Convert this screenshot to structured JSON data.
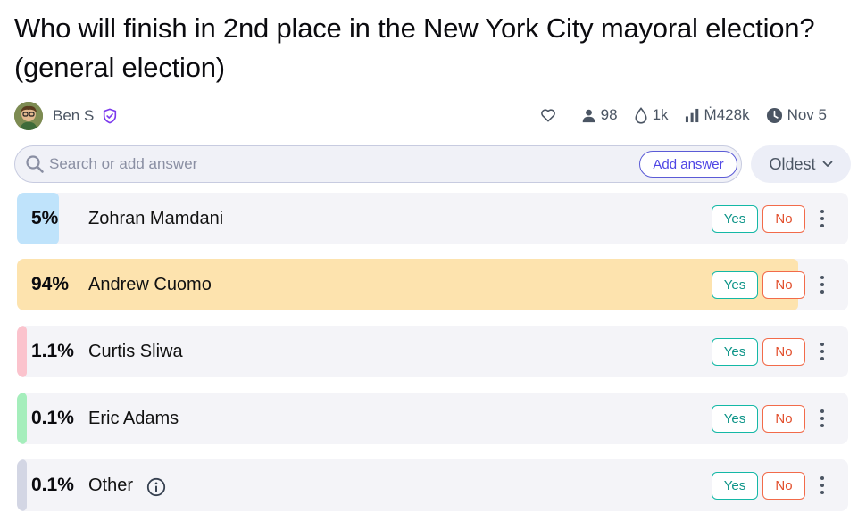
{
  "market": {
    "title": "Who will finish in 2nd place in the New York City mayoral election? (general election)",
    "author": "Ben S"
  },
  "stats": {
    "traders": "98",
    "liquidity": "1k",
    "volume": "Ṁ428k",
    "close_date": "Nov 5"
  },
  "search": {
    "placeholder": "Search or add answer",
    "add_label": "Add answer"
  },
  "sort": {
    "label": "Oldest"
  },
  "answers": [
    {
      "percent": "5%",
      "name": "Zohran Mamdani",
      "probability": 0.05,
      "color": "#bfe3fb",
      "yes": "Yes",
      "no": "No"
    },
    {
      "percent": "94%",
      "name": "Andrew Cuomo",
      "probability": 0.94,
      "color": "#fde3ae",
      "yes": "Yes",
      "no": "No"
    },
    {
      "percent": "1.1%",
      "name": "Curtis Sliwa",
      "probability": 0.011,
      "color": "#fbc3cd",
      "yes": "Yes",
      "no": "No"
    },
    {
      "percent": "0.1%",
      "name": "Eric Adams",
      "probability": 0.001,
      "color": "#a5eebc",
      "yes": "Yes",
      "no": "No"
    },
    {
      "percent": "0.1%",
      "name": "Other",
      "probability": 0.001,
      "color": "#d3d6e4",
      "yes": "Yes",
      "no": "No"
    }
  ],
  "colors": {
    "accent": "#5b5bd6",
    "yes": "#14b8a6",
    "no": "#f26b4a"
  }
}
